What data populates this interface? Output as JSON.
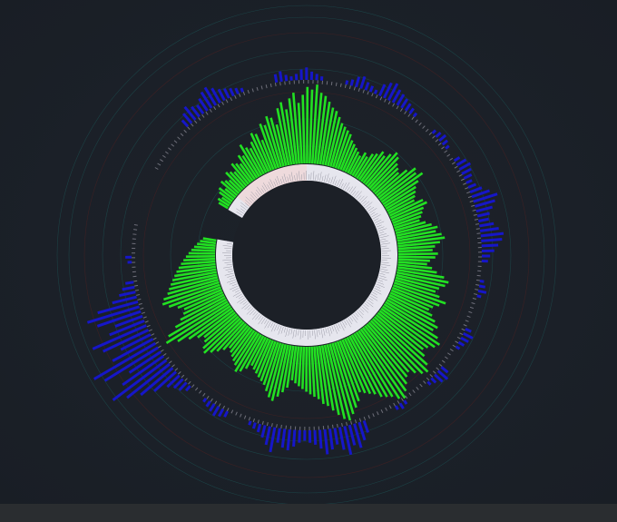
{
  "colors": {
    "background": "#1b2028",
    "bottom_bar": "#2a2d30",
    "inner_ring_fill": "#e6e6ee",
    "inner_ring_accent": "#f1d4d4",
    "inner_disc": "#1c2027",
    "inner_series": "#22e022",
    "outer_series": "#1616c8",
    "track_ticks": "#6f6f7a",
    "grid_teal": "#1d5c5c",
    "grid_red": "#5a2020"
  },
  "chart_data": {
    "type": "radial_bar",
    "gap_degrees": 20,
    "start_angle_degrees": -60,
    "grid": true,
    "series": [
      {
        "values": [
          2,
          3,
          2,
          4,
          5,
          3,
          6,
          5,
          4,
          7,
          6,
          5,
          8,
          7,
          6,
          9,
          8,
          12,
          10,
          9,
          11,
          14,
          13,
          10,
          16,
          15,
          18,
          17,
          14,
          20,
          22,
          19,
          23,
          25,
          21,
          24,
          27,
          26,
          28,
          25,
          24,
          22,
          20,
          19,
          17,
          15,
          14,
          13,
          12,
          10,
          9,
          8,
          7,
          6,
          8,
          7,
          9,
          10,
          12,
          11,
          13,
          15,
          14,
          12,
          11,
          10,
          13,
          16,
          15,
          17,
          14,
          12,
          11,
          10,
          9,
          12,
          13,
          11,
          10,
          9,
          8,
          10,
          12,
          14,
          13,
          15,
          16,
          14,
          12,
          11,
          13,
          12,
          10,
          9,
          11,
          13,
          16,
          18,
          17,
          15,
          14,
          16,
          19,
          17,
          15,
          14,
          16,
          18,
          20,
          19,
          22,
          24,
          23,
          21,
          20,
          22,
          25,
          27,
          26,
          24,
          22,
          23,
          25,
          27,
          29,
          28,
          26,
          25,
          24,
          22,
          21,
          20,
          19,
          22,
          24,
          26,
          28,
          27,
          25,
          23,
          21,
          20,
          18,
          17,
          16,
          15,
          14,
          13,
          12,
          11,
          14,
          16,
          18,
          20,
          19,
          17,
          15,
          14,
          13,
          12,
          11,
          10,
          12,
          14,
          15,
          13,
          12,
          11,
          10,
          9,
          11,
          13,
          15,
          17,
          16,
          14,
          13,
          15,
          18,
          22,
          26,
          24,
          20,
          17,
          15,
          14,
          16,
          19,
          21,
          20,
          18,
          17,
          16,
          15,
          14,
          13,
          12,
          11,
          10,
          9,
          8,
          7,
          6,
          5,
          4,
          3
        ]
      },
      {
        "values": [
          0,
          0,
          0,
          0,
          0,
          0,
          0,
          0,
          0,
          0,
          4,
          6,
          8,
          6,
          5,
          7,
          9,
          10,
          8,
          6,
          5,
          4,
          3,
          2,
          0,
          0,
          0,
          0,
          0,
          0,
          4,
          5,
          3,
          2,
          3,
          5,
          6,
          4,
          3,
          2,
          0,
          0,
          0,
          0,
          2,
          3,
          5,
          6,
          4,
          3,
          2,
          6,
          8,
          9,
          7,
          6,
          5,
          4,
          3,
          2,
          0,
          0,
          0,
          0,
          2,
          3,
          4,
          3,
          2,
          0,
          0,
          3,
          5,
          6,
          5,
          4,
          3,
          4,
          6,
          9,
          12,
          10,
          8,
          6,
          5,
          7,
          9,
          11,
          10,
          8,
          6,
          4,
          3,
          0,
          0,
          0,
          2,
          3,
          4,
          2,
          0,
          0,
          0,
          0,
          0,
          0,
          3,
          5,
          4,
          3,
          2,
          0,
          0,
          0,
          0,
          4,
          6,
          5,
          3,
          2,
          0,
          0,
          0,
          0,
          0,
          2,
          3,
          2,
          0,
          0,
          0,
          0,
          0,
          0,
          6,
          9,
          12,
          10,
          14,
          11,
          8,
          10,
          12,
          9,
          7,
          6,
          5,
          6,
          8,
          10,
          9,
          7,
          12,
          9,
          6,
          4,
          3,
          2,
          0,
          0,
          0,
          0,
          3,
          4,
          5,
          4,
          3,
          2,
          0,
          0,
          0,
          3,
          5,
          6,
          8,
          14,
          20,
          26,
          32,
          24,
          18,
          30,
          34,
          22,
          16,
          24,
          28,
          18,
          14,
          22,
          26,
          20,
          12,
          8,
          6,
          4,
          0,
          0,
          0,
          2,
          3,
          0,
          0,
          0,
          0,
          0,
          0
        ]
      }
    ]
  }
}
